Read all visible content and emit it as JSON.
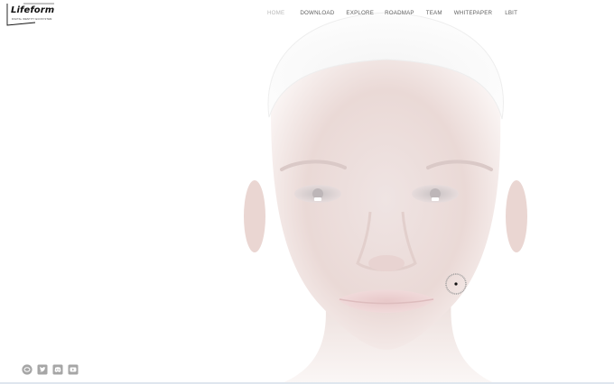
{
  "brand": {
    "name": "Lifeform",
    "tagline": "DIGITAL IDENTITY ECOSYSTEM"
  },
  "nav": {
    "items": [
      {
        "label": "HOME",
        "active": true
      },
      {
        "label": "DOWNLOAD",
        "active": false
      },
      {
        "label": "EXPLORE",
        "active": false
      },
      {
        "label": "ROADMAP",
        "active": false
      },
      {
        "label": "TEAM",
        "active": false
      },
      {
        "label": "WHITEPAPER",
        "active": false
      },
      {
        "label": "LBIT",
        "active": false
      }
    ]
  },
  "cursor_badge": {
    "icon": "explore-cursor-icon"
  },
  "socials": [
    {
      "icon": "discourse-icon"
    },
    {
      "icon": "twitter-icon"
    },
    {
      "icon": "discord-icon"
    },
    {
      "icon": "youtube-icon"
    }
  ],
  "colors": {
    "nav_text": "#5f5f5f",
    "nav_active": "#b9b9b9",
    "icon_gray": "#a6a6a6",
    "face_tone": "#f1e2df"
  }
}
